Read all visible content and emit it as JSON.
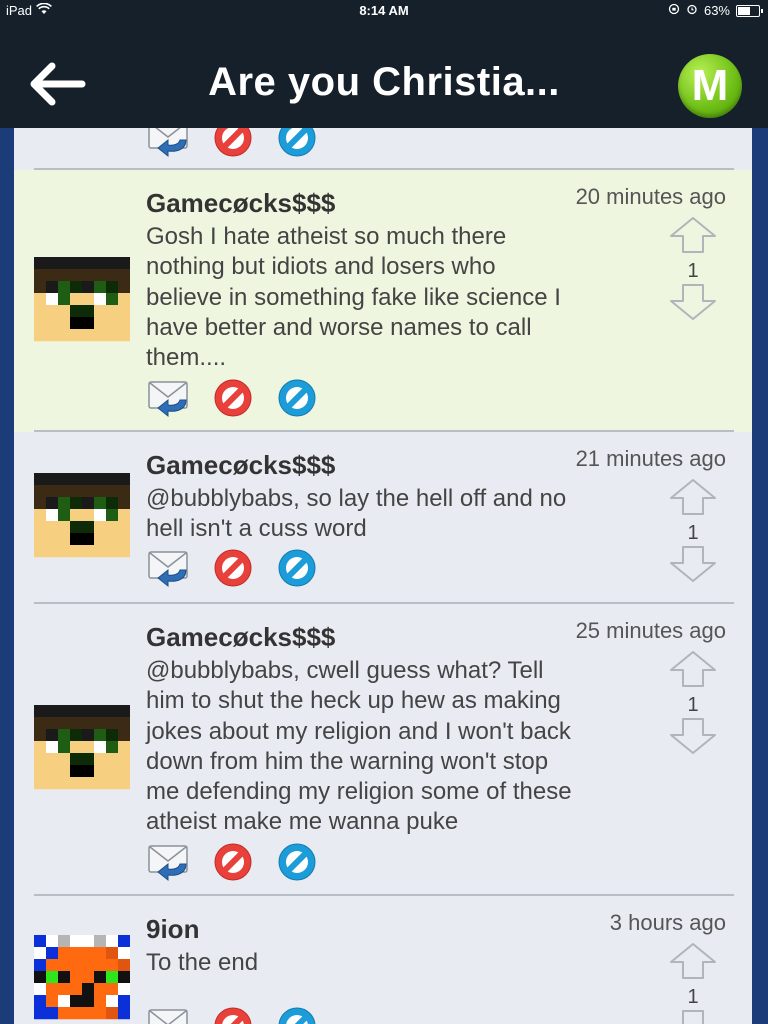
{
  "status_bar": {
    "device": "iPad",
    "time": "8:14 AM",
    "battery": "63%",
    "battery_fraction": 0.63
  },
  "nav": {
    "title": "Are you Christia...",
    "logo_letter": "M"
  },
  "comments": [
    {
      "author": "Gamecøcks$$$",
      "time": "20 minutes ago",
      "lines": [
        "Gosh I hate atheist so much there",
        "nothing but idiots and losers who",
        "believe in something fake like science I",
        "have better and worse names to call",
        "them...."
      ],
      "votes": "1"
    },
    {
      "author": "Gamecøcks$$$",
      "time": "21 minutes ago",
      "lines": [
        "@bubblybabs, so lay the hell off and no",
        "hell isn't a cuss word"
      ],
      "votes": "1"
    },
    {
      "author": "Gamecøcks$$$",
      "time": "25 minutes ago",
      "lines": [
        "@bubblybabs, cwell guess what? Tell",
        "him to shut the heck up hew as making",
        "jokes about my religion and I won't back",
        "down from him the warning won't stop",
        "me defending my religion some of these",
        "atheist make me wanna puke"
      ],
      "votes": "1"
    },
    {
      "author": "9ion",
      "time": "3 hours ago",
      "lines": [
        "To the end"
      ],
      "votes": "1"
    }
  ],
  "icons": {
    "back": "back-arrow-icon",
    "reply": "reply-mail-icon",
    "report": "report-icon",
    "block": "block-icon",
    "upvote": "upvote-arrow-icon",
    "downvote": "downvote-arrow-icon"
  },
  "colors": {
    "nav_bg": "#15202b",
    "highlight_bg": "#eef6e0",
    "report_red": "#e8413b",
    "block_blue": "#1c9cd8",
    "logo_green": "#6cbc15"
  }
}
